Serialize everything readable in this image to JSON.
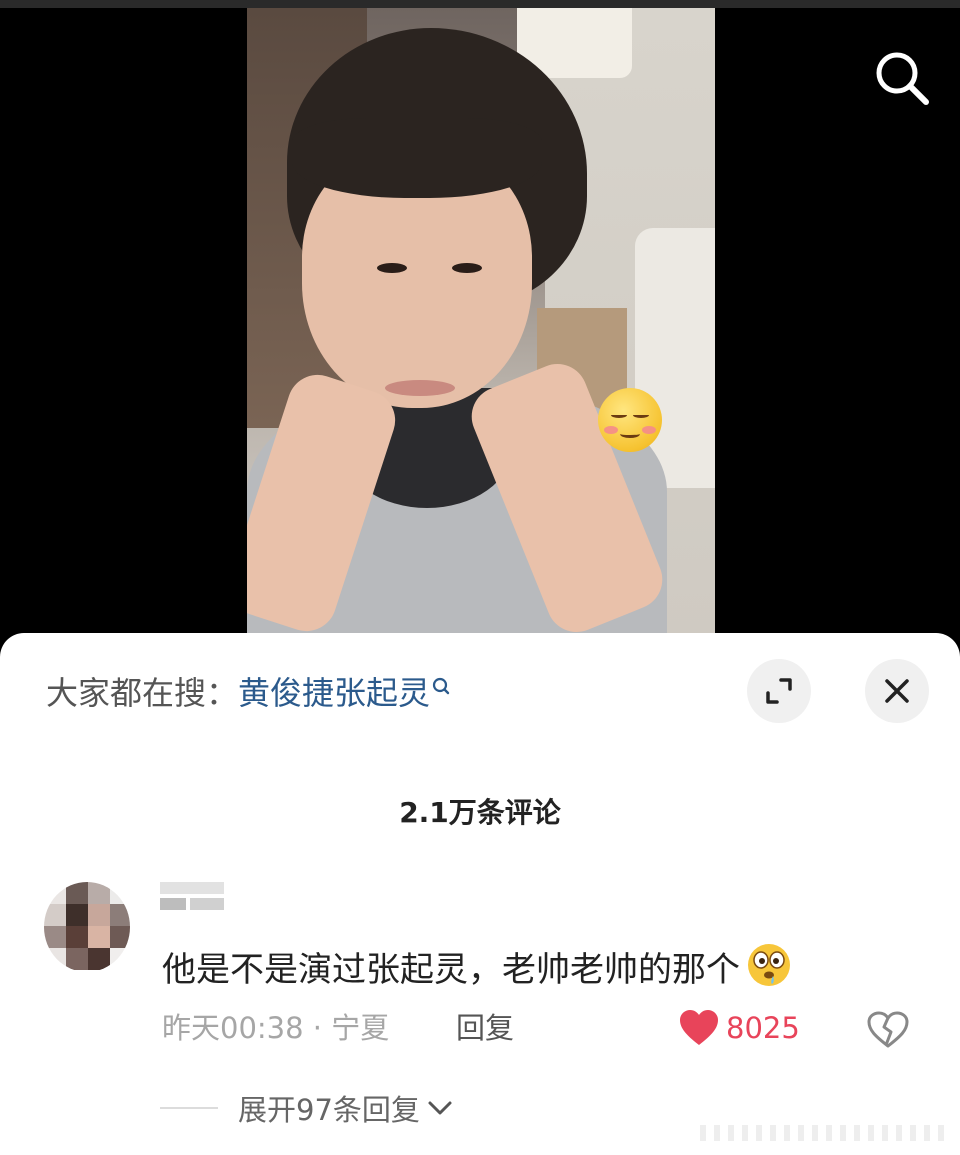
{
  "video": {
    "search_icon": "search-icon",
    "sticker_icon": "blushing-smile-emoji-icon"
  },
  "sheet": {
    "hot_search_prefix": "大家都在搜：",
    "hot_search_term": "黄俊捷张起灵",
    "hot_search_icon": "search-small-icon",
    "expand_icon": "expand-icon",
    "close_icon": "close-icon",
    "comment_count": "2.1万条评论"
  },
  "comment": {
    "text": "他是不是演过张起灵，老帅老帅的那个",
    "emoji_icon": "drooling-eyes-emoji-icon",
    "time_location": "昨天00:38 · 宁夏",
    "reply_label": "回复",
    "like_count": "8025",
    "like_icon": "heart-icon",
    "dislike_icon": "broken-heart-icon",
    "expand_replies_label": "展开97条回复",
    "expand_icon": "chevron-down-icon"
  },
  "colors": {
    "hot_term": "#2b5a8c",
    "like": "#e8445a",
    "meta": "#a6a6a6"
  }
}
